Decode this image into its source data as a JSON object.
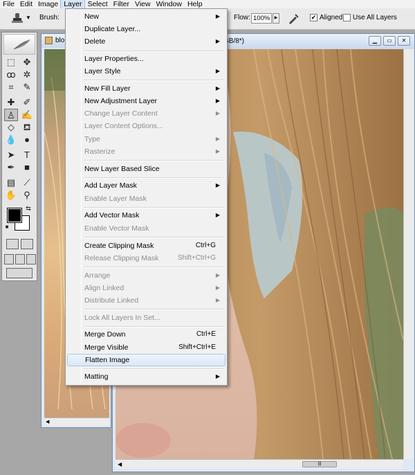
{
  "menubar": {
    "items": [
      {
        "label": "File"
      },
      {
        "label": "Edit"
      },
      {
        "label": "Image"
      },
      {
        "label": "Layer"
      },
      {
        "label": "Select"
      },
      {
        "label": "Filter"
      },
      {
        "label": "View"
      },
      {
        "label": "Window"
      },
      {
        "label": "Help"
      }
    ],
    "active": "Layer"
  },
  "options": {
    "brush_label": "Brush:",
    "flow_label": "Flow:",
    "flow_value": "100%",
    "aligned_label": "Aligned",
    "aligned_checked": true,
    "use_all_layers_label": "Use All Layers",
    "use_all_layers_checked": false
  },
  "documents": {
    "back_title": "blo",
    "front_title": "GB/8*)"
  },
  "layer_menu": {
    "items": [
      {
        "label": "New",
        "submenu": true,
        "enabled": true
      },
      {
        "label": "Duplicate Layer...",
        "enabled": true
      },
      {
        "label": "Delete",
        "submenu": true,
        "enabled": true
      },
      {
        "label": "Layer Properties...",
        "enabled": true
      },
      {
        "label": "Layer Style",
        "submenu": true,
        "enabled": true
      },
      {
        "label": "New Fill Layer",
        "submenu": true,
        "enabled": true
      },
      {
        "label": "New Adjustment Layer",
        "submenu": true,
        "enabled": true
      },
      {
        "label": "Change Layer Content",
        "submenu": true,
        "enabled": false
      },
      {
        "label": "Layer Content Options...",
        "enabled": false
      },
      {
        "label": "Type",
        "submenu": true,
        "enabled": false
      },
      {
        "label": "Rasterize",
        "submenu": true,
        "enabled": false
      },
      {
        "label": "New Layer Based Slice",
        "enabled": true
      },
      {
        "label": "Add Layer Mask",
        "submenu": true,
        "enabled": true
      },
      {
        "label": "Enable Layer Mask",
        "enabled": false
      },
      {
        "label": "Add Vector Mask",
        "submenu": true,
        "enabled": true
      },
      {
        "label": "Enable Vector Mask",
        "enabled": false
      },
      {
        "label": "Create Clipping Mask",
        "shortcut": "Ctrl+G",
        "enabled": true
      },
      {
        "label": "Release Clipping Mask",
        "shortcut": "Shift+Ctrl+G",
        "enabled": false
      },
      {
        "label": "Arrange",
        "submenu": true,
        "enabled": false
      },
      {
        "label": "Align Linked",
        "submenu": true,
        "enabled": false
      },
      {
        "label": "Distribute Linked",
        "submenu": true,
        "enabled": false
      },
      {
        "label": "Lock All Layers In Set...",
        "enabled": false
      },
      {
        "label": "Merge Down",
        "shortcut": "Ctrl+E",
        "enabled": true
      },
      {
        "label": "Merge Visible",
        "shortcut": "Shift+Ctrl+E",
        "enabled": true
      },
      {
        "label": "Flatten Image",
        "enabled": true,
        "highlighted": true
      },
      {
        "label": "Matting",
        "submenu": true,
        "enabled": true
      }
    ]
  },
  "colors": {
    "menu_highlight": "#dbe8f6",
    "disabled_text": "#8d8d8d",
    "foreground_swatch": "#000000",
    "background_swatch": "#ffffff"
  }
}
